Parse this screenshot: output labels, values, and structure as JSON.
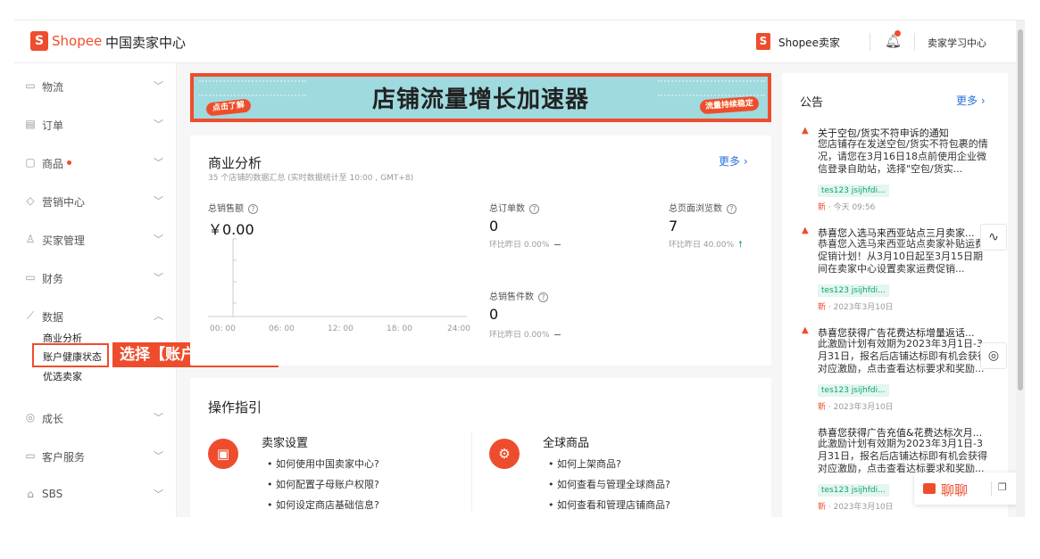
{
  "header": {
    "logo_mark": "S",
    "brand": "Shopee",
    "center_title": "中国卖家中心",
    "seller_mark": "S",
    "seller_label": "Shopee卖家",
    "learn_label": "卖家学习中心"
  },
  "sidebar": {
    "items": [
      {
        "label": "物流",
        "icon": "truck-icon"
      },
      {
        "label": "订单",
        "icon": "order-icon"
      },
      {
        "label": "商品",
        "icon": "product-icon"
      },
      {
        "label": "营销中心",
        "icon": "tag-icon"
      },
      {
        "label": "买家管理",
        "icon": "user-icon"
      },
      {
        "label": "财务",
        "icon": "wallet-icon"
      },
      {
        "label": "数据",
        "icon": "chart-icon"
      },
      {
        "label": "成长",
        "icon": "growth-icon"
      },
      {
        "label": "客户服务",
        "icon": "service-icon"
      },
      {
        "label": "SBS",
        "icon": "sbs-icon"
      }
    ],
    "sub_items": [
      "商业分析",
      "账户健康状态",
      "优选卖家"
    ],
    "callout": "选择【账户健康状态】"
  },
  "banner": {
    "title": "店铺流量增长加速器",
    "tag_left": "点击了解",
    "tag_right": "流量持续稳定"
  },
  "business": {
    "title": "商业分析",
    "subtitle": "35 个店铺的数据汇总 (实时数据统计至 10:00 , GMT+8)",
    "more": "更多 ›",
    "sales_label": "总销售额",
    "sales_value": "￥0.00",
    "orders_label": "总订单数",
    "orders_value": "0",
    "orders_cmp": "环比昨日 0.00%",
    "views_label": "总页面浏览数",
    "views_value": "7",
    "views_cmp": "环比昨日 40.00%",
    "units_label": "总销售件数",
    "units_value": "0",
    "units_cmp": "环比昨日 0.00%",
    "x_ticks": [
      "00: 00",
      "06: 00",
      "12: 00",
      "18: 00",
      "24:00"
    ]
  },
  "guide": {
    "title": "操作指引",
    "col1_head": "卖家设置",
    "col1_items": [
      "如何使用中国卖家中心?",
      "如何配置子母账户权限?",
      "如何设定商店基础信息?"
    ],
    "col2_head": "全球商品",
    "col2_items": [
      "如何上架商品?",
      "如何查看与管理全球商品?",
      "如何查看和管理店铺商品?"
    ]
  },
  "announcements": {
    "title": "公告",
    "more": "更多 ›",
    "items": [
      {
        "head": "关于空包/货实不符申诉的通知",
        "body": "您店铺存在发送空包/货实不符包裹的情况，请您在3月16日18点前使用企业微信登录自助站，选择\"空包/货实...",
        "tag": "tes123 jsijhfdi...",
        "new": "新",
        "time": " · 今天 09:56"
      },
      {
        "head": "恭喜您入选马来西亚站点三月卖家...",
        "body": "恭喜您入选马来西亚站点卖家补贴运费促销计划！从3月10日起至3月15日期间在卖家中心设置卖家运费促销...",
        "tag": "tes123 jsijhfdi...",
        "new": "新",
        "time": " · 2023年3月10日"
      },
      {
        "head": "恭喜您获得广告花费达标增量返话...",
        "body": "此激励计划有效期为2023年3月1日-3月31日，报名后店铺达标即有机会获得对应激励，点击查看达标要求和奖励...",
        "tag": "tes123 jsijhfdi...",
        "new": "新",
        "time": " · 2023年3月10日"
      },
      {
        "head": "恭喜您获得广告充值&花费达标次月...",
        "body": "此激励计划有效期为2023年3月1日-3月31日，报名后店铺达标即有机会获得对应激励，点击查看达标要求和奖励...",
        "tag": "tes123 jsijhfdi...",
        "new": "新",
        "time": " · 2023年3月10日"
      }
    ]
  },
  "chat": {
    "label": "聊聊"
  }
}
